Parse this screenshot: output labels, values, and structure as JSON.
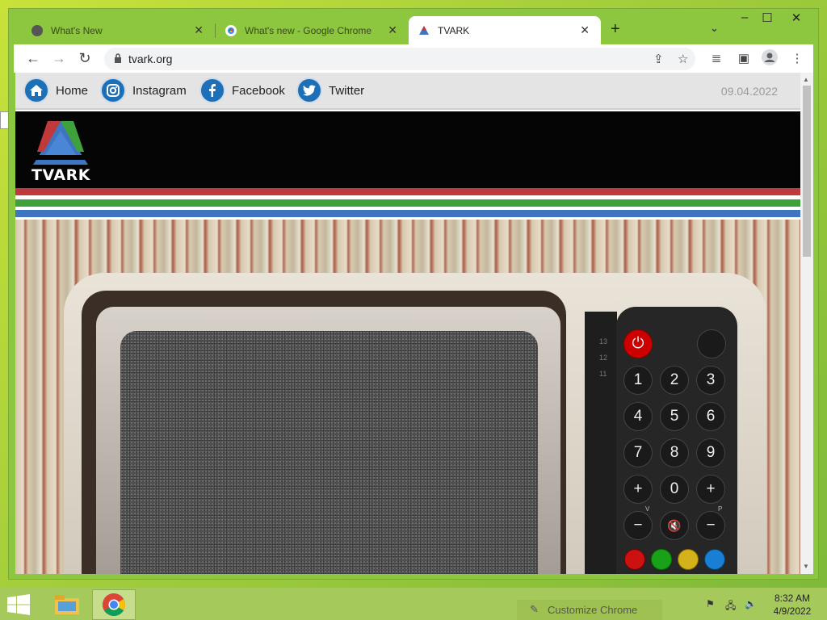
{
  "browser": {
    "tabs": [
      {
        "title": "What's New",
        "icon": "chrome-gray-icon"
      },
      {
        "title": "What's new - Google Chrome",
        "icon": "chrome-icon"
      },
      {
        "title": "TVARK",
        "icon": "tvark-icon"
      }
    ],
    "url": "tvark.org",
    "accent": "#8dc63f"
  },
  "site": {
    "nav": [
      {
        "label": "Home",
        "icon": "home-icon"
      },
      {
        "label": "Instagram",
        "icon": "instagram-icon"
      },
      {
        "label": "Facebook",
        "icon": "facebook-icon"
      },
      {
        "label": "Twitter",
        "icon": "twitter-icon"
      }
    ],
    "date": "09.04.2022",
    "logo": "TVARK",
    "stripe_colors": [
      "#c0393b",
      "#3fa13b",
      "#3f74c0"
    ]
  },
  "remote": {
    "numbers": [
      "1",
      "2",
      "3",
      "4",
      "5",
      "6",
      "7",
      "8",
      "9",
      "0"
    ],
    "plus": "+",
    "minus": "−",
    "volume_label": "V",
    "program_label": "P",
    "color_buttons": [
      "#cc1111",
      "#1aa11a",
      "#d4b21a",
      "#1a7fd4"
    ],
    "channel_numbers": [
      "13",
      "12",
      "11"
    ]
  },
  "taskbar": {
    "customize_label": "Customize Chrome",
    "time": "8:32 AM",
    "date": "4/9/2022"
  }
}
